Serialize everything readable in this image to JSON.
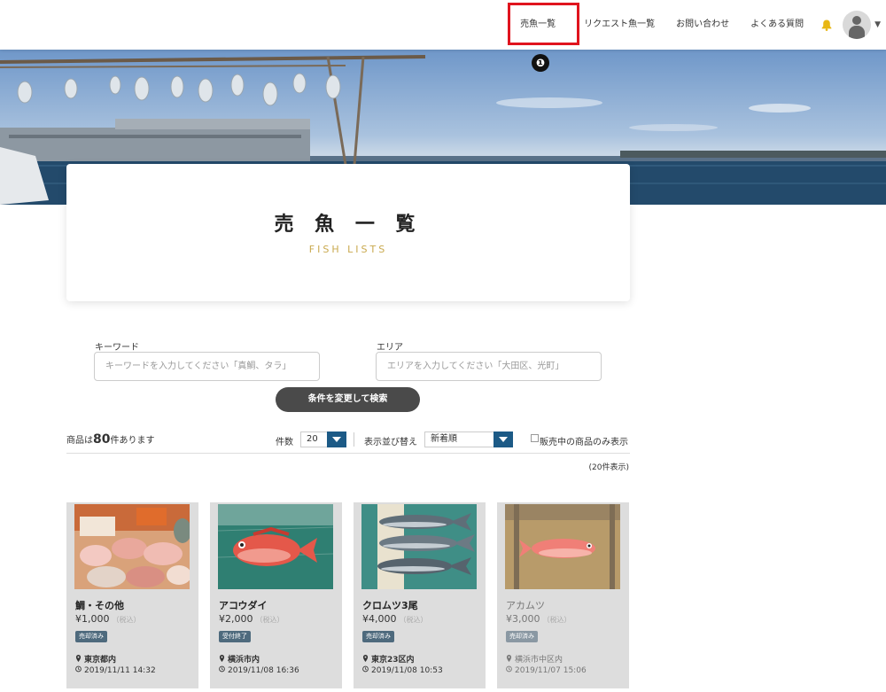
{
  "nav": {
    "items": [
      "売魚一覧",
      "リクエスト魚一覧",
      "お問い合わせ",
      "よくある質問"
    ],
    "marker": "❶"
  },
  "page": {
    "title": "売 魚 一 覧",
    "subtitle": "FISH LISTS"
  },
  "search": {
    "keyword_label": "キーワード",
    "keyword_placeholder": "キーワードを入力してください「真鯛、タラ」",
    "area_label": "エリア",
    "area_placeholder": "エリアを入力してください「大田区、光町」",
    "submit_label": "条件を変更して検索"
  },
  "results": {
    "count_prefix": "商品は",
    "count": "80",
    "count_suffix": "件あります",
    "per_page_label": "件数",
    "per_page_value": "20",
    "sort_label": "表示並び替え",
    "sort_value": "新着順",
    "only_on_sale_label": "販売中の商品のみ表示",
    "shown_text": "(20件表示)"
  },
  "products": [
    {
      "name": "鯛・その他",
      "price": "¥1,000",
      "tax": "（税込）",
      "status": "売却済み",
      "location": "東京都内",
      "date": "2019/11/11 14:32"
    },
    {
      "name": "アコウダイ",
      "price": "¥2,000",
      "tax": "（税込）",
      "status": "受付終了",
      "location": "横浜市内",
      "date": "2019/11/08 16:36"
    },
    {
      "name": "クロムツ3尾",
      "price": "¥4,000",
      "tax": "（税込）",
      "status": "売却済み",
      "location": "東京23区内",
      "date": "2019/11/08 10:53"
    },
    {
      "name": "アカムツ",
      "price": "¥3,000",
      "tax": "（税込）",
      "status": "売却済み",
      "location": "横浜市中区内",
      "date": "2019/11/07 15:06"
    }
  ],
  "colors": {
    "accent_gold": "#c9a94e",
    "highlight_red": "#e0141e",
    "select_blue": "#1c5a86",
    "badge": "#4e6a7d"
  }
}
